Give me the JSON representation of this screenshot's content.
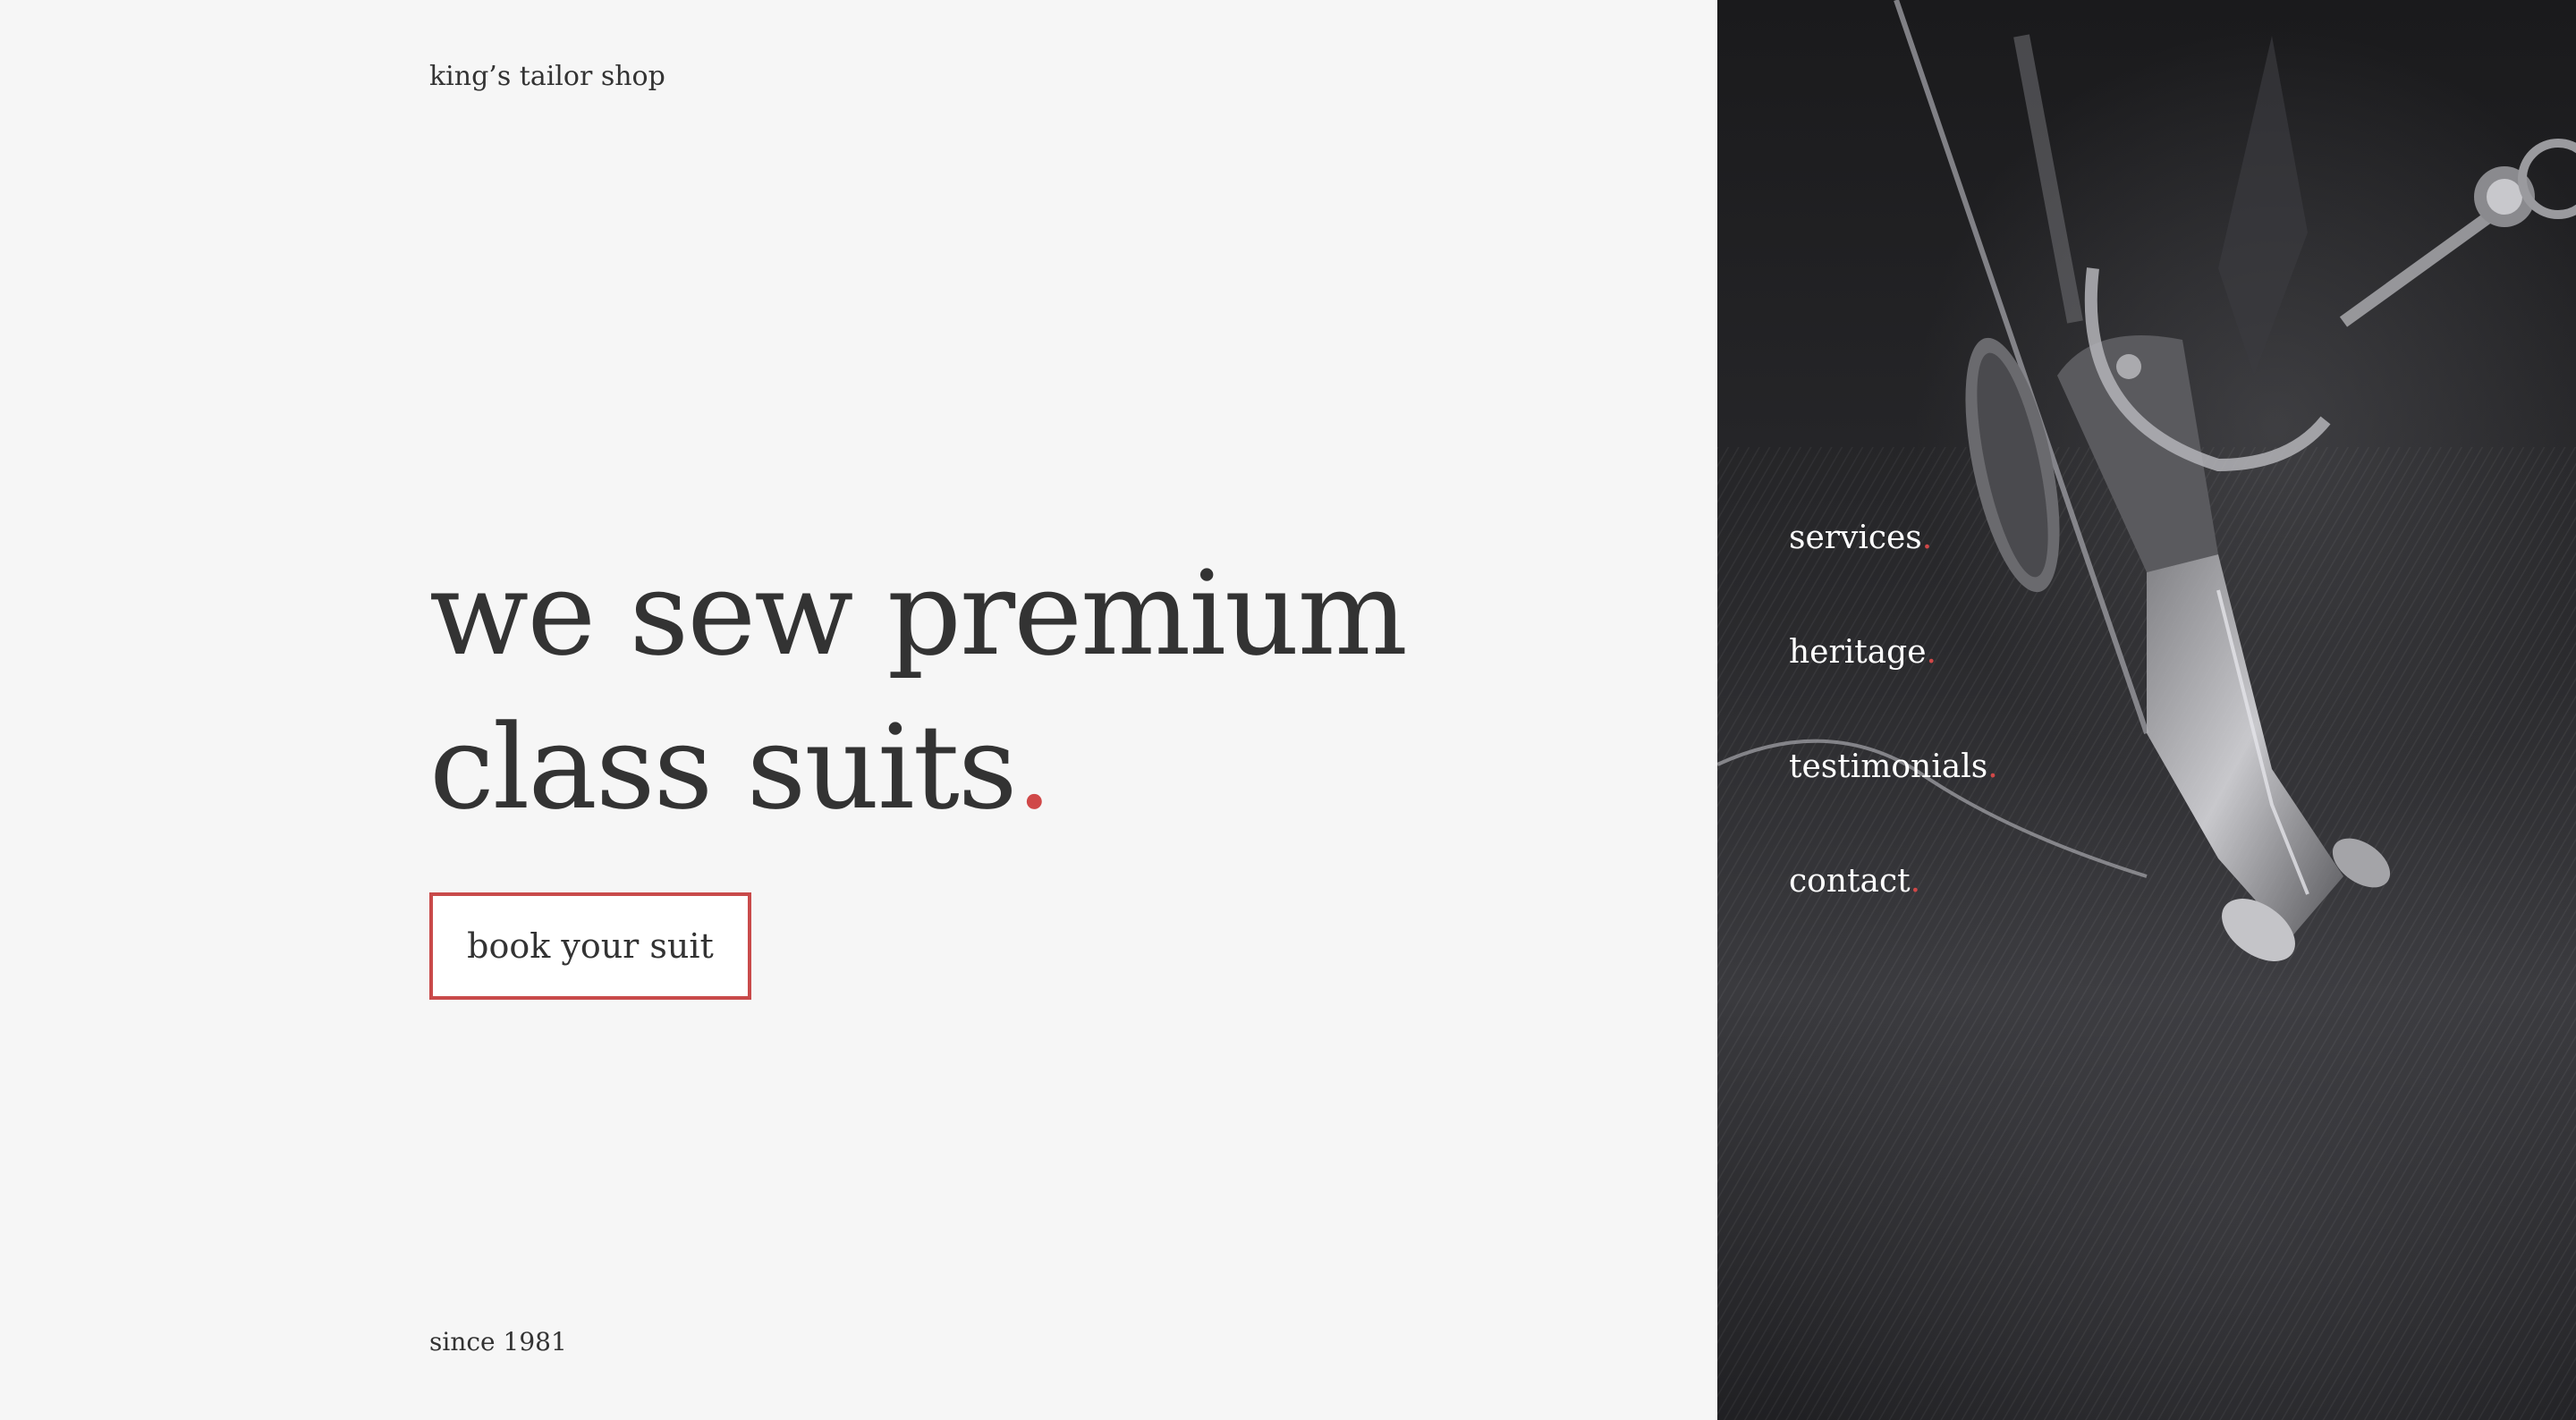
{
  "header": {
    "brand": "king’s tailor shop"
  },
  "hero": {
    "line1": "we sew premium",
    "line2": "class suits",
    "period": "."
  },
  "cta": {
    "label": "book your suit"
  },
  "footer": {
    "since": "since 1981"
  },
  "nav": {
    "items": [
      {
        "label": "services",
        "period": "."
      },
      {
        "label": "heritage",
        "period": "."
      },
      {
        "label": "testimonials",
        "period": "."
      },
      {
        "label": "contact",
        "period": "."
      }
    ]
  },
  "image": {
    "icon": "sewing-machine-photo"
  },
  "colors": {
    "accent": "#d04848",
    "text": "#333333",
    "background": "#f6f6f6",
    "panel": "#1f1f22"
  }
}
